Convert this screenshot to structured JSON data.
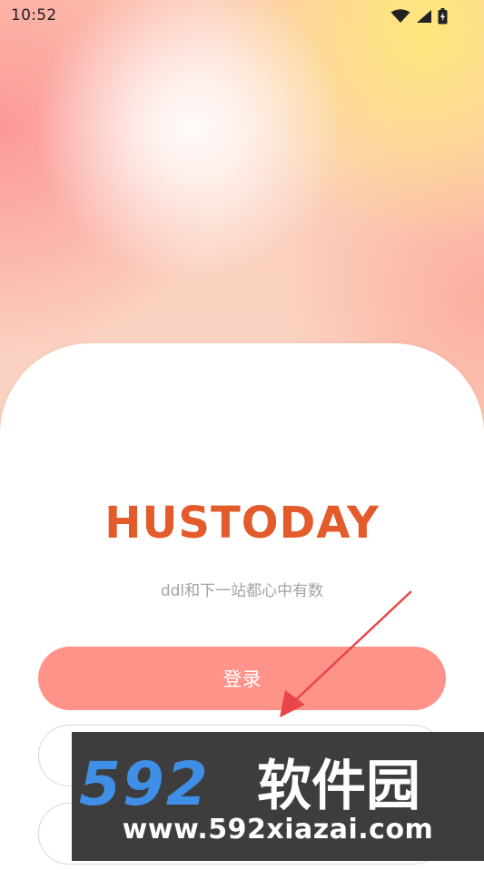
{
  "status_bar": {
    "time": "10:52",
    "icons": [
      "wifi-icon",
      "signal-icon",
      "battery-charging-icon"
    ]
  },
  "app": {
    "title": "HUSTODAY",
    "subtitle": "ddl和下一站都心中有数"
  },
  "buttons": {
    "login_label": "登录"
  },
  "watermark": {
    "brand": "592软件园",
    "url": "www.592xiazai.com"
  },
  "colors": {
    "title": "#e35a2b",
    "login_button": "#ff938a",
    "subtitle": "#a3a3a3",
    "arrow": "#e8464a",
    "watermark_bg": "#3d3d3d",
    "watermark_digits": "#3f8fe6"
  }
}
